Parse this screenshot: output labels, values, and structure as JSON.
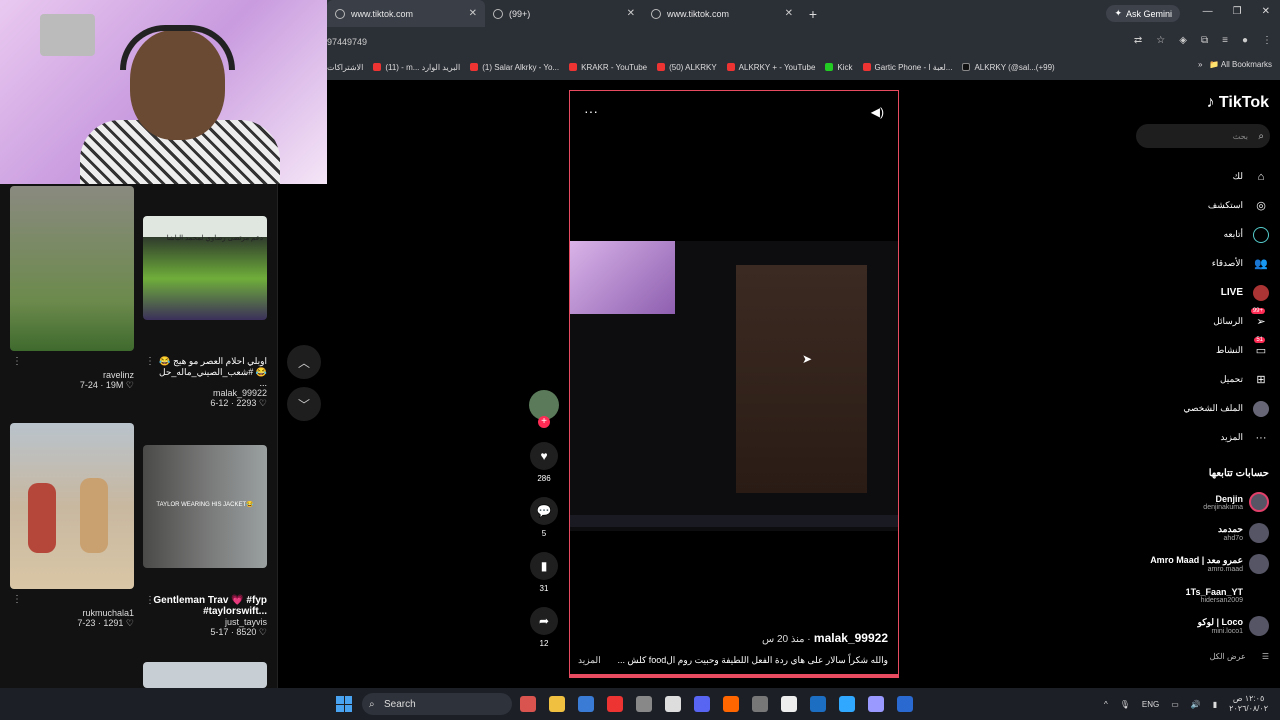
{
  "browser": {
    "tabs": [
      {
        "label": "www.tiktok.com",
        "active": true
      },
      {
        "label": "(99+)",
        "active": false
      },
      {
        "label": "www.tiktok.com",
        "active": false
      }
    ],
    "new_tab": "+",
    "ask_gemini": "Ask Gemini",
    "url": "97449749",
    "bookmarks": [
      "الاشتراكات",
      "(11) - m... البريد الوارد",
      "(1) Salar Alkrky - Yo...",
      "KRAKR - YouTube",
      "(50) ALKRKY",
      "ALKRKY + - YouTube",
      "Kick",
      "Gartic Phone - لعبة ا...",
      "ALKRKY (@sal...(+99)"
    ],
    "bookmark_icons": [
      "gmail-icon",
      "youtube-icon",
      "youtube-icon",
      "reddit-icon",
      "youtube-icon",
      "kick-icon",
      "gartic-icon",
      "tiktok-icon"
    ],
    "all_bookmarks": "All Bookmarks"
  },
  "grid": {
    "items": [
      {
        "title": "",
        "author": "ravelinz",
        "stats": "7-24 · 19M ♡"
      },
      {
        "title": "اوبلي احلام العصر مو هيج 😂 #شعب_الصيني_ماله_حل 😂 ...",
        "author": "malak_99922",
        "stats": "6-12 · 2293 ♡",
        "overlay": "دعم مرتضى رضاوي لمحمد الباشا"
      },
      {
        "title": "",
        "author": "rukmuchala1",
        "stats": "7-23 · 1291 ♡"
      },
      {
        "title": "Gentleman Trav 💗 #fyp #taylorswift...",
        "author": "just_tayvis",
        "stats": "5-17 · 8520 ♡",
        "overlay": "TAYLOR WEARING HIS JACKET😂"
      }
    ]
  },
  "video": {
    "author": "malak_99922",
    "time": "منذ 20 س",
    "caption": "والله شكراً سالار على هاي ردة الفعل اللطيفة وحبيت روم الfood كلش ...",
    "more": "المزيد",
    "likes": "286",
    "comments": "5",
    "saves": "31",
    "shares": "12"
  },
  "sidebar": {
    "logo": "TikTok",
    "search_placeholder": "بحث",
    "nav": [
      {
        "label": "لك",
        "icon": "home-icon"
      },
      {
        "label": "استكشف",
        "icon": "compass-icon"
      },
      {
        "label": "أتابعه",
        "icon": "following-icon"
      },
      {
        "label": "الأصدقاء",
        "icon": "friends-icon"
      },
      {
        "label": "LIVE",
        "icon": "live-icon"
      },
      {
        "label": "الرسائل",
        "icon": "messages-icon",
        "badge": "99+"
      },
      {
        "label": "النشاط",
        "icon": "activity-icon",
        "badge": "51"
      },
      {
        "label": "تحميل",
        "icon": "upload-icon"
      },
      {
        "label": "الملف الشخصي",
        "icon": "profile-icon"
      },
      {
        "label": "المزيد",
        "icon": "more-icon"
      }
    ],
    "following_title": "حسابات تتابعها",
    "accounts": [
      {
        "name": "Denjin",
        "handle": "denjinakuma"
      },
      {
        "name": "حمدمد",
        "handle": "ahd7o"
      },
      {
        "name": "Amro Maad | عمرو معد",
        "handle": "amro.maad"
      },
      {
        "name": "1Ts_Faan_YT",
        "handle": "hidersan2009"
      },
      {
        "name": "لوكو | Loco",
        "handle": "mini.loco1"
      }
    ],
    "see_all": "عرض الكل"
  },
  "taskbar": {
    "search": "Search",
    "lang": "ENG",
    "time": "١٢:٠٥ ص",
    "date": "٢٠٢٦/٠٨/٠٢",
    "icon_colors": [
      "#d9534f",
      "#f0c040",
      "#3a7bd5",
      "#e33",
      "#888",
      "#ddd",
      "#5865f2",
      "#f60",
      "#777",
      "#eee",
      "#1b6ec2",
      "#31a8ff",
      "#9999ff",
      "#2a6ad0"
    ]
  }
}
